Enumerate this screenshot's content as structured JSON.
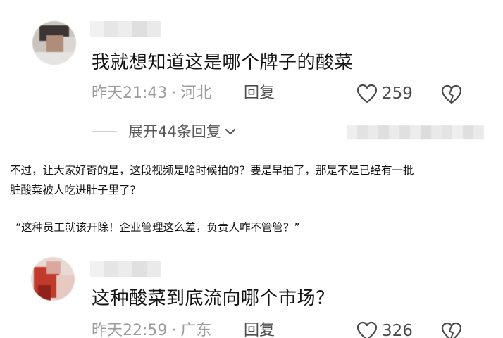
{
  "comments": [
    {
      "text": "我就想知道这是哪个牌子的酸菜",
      "time": "昨天21:43",
      "location": "河北",
      "reply_label": "回复",
      "likes": "259",
      "expand_label": "展开44条回复"
    },
    {
      "text": "这种酸菜到底流向哪个市场？",
      "time": "昨天22:59",
      "location": "广东",
      "reply_label": "回复",
      "likes": "326"
    }
  ],
  "article": {
    "line1": "不过，让大家好奇的是，这段视频是啥时候拍的？要是早拍了，那是不是已经有一批",
    "line2": "脏酸菜被人吃进肚子里了？",
    "quote": "“这种员工就该开除！企业管理这么差，负责人咋不管管？”"
  },
  "icons": {
    "like": "heart-outline-icon",
    "dislike": "broken-heart-icon",
    "expand": "chevron-down-icon"
  },
  "colors": {
    "meta_text": "#9c9c9c",
    "body_text": "#141414"
  }
}
